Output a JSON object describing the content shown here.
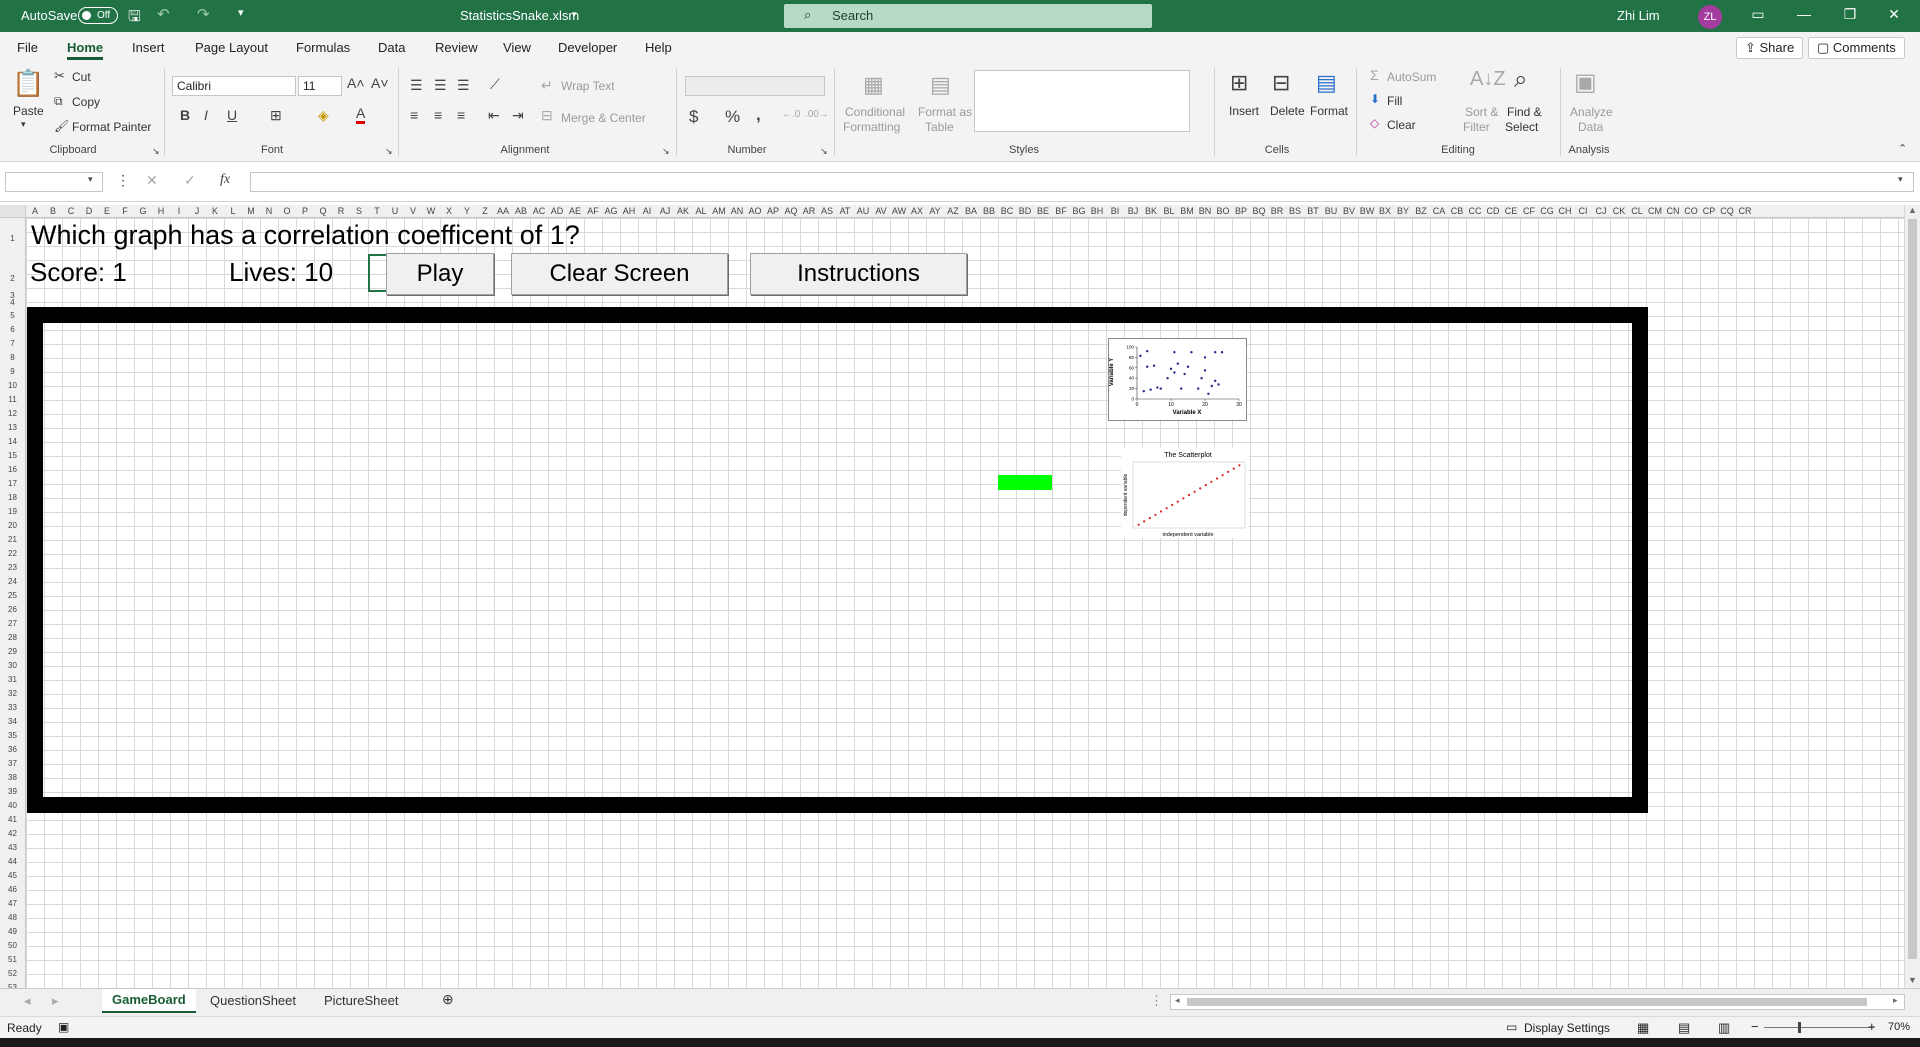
{
  "titlebar": {
    "autosave_label": "AutoSave",
    "autosave_state": "Off",
    "file_name": "StatisticsSnake.xlsm",
    "search_placeholder": "Search",
    "user_name": "Zhi Lim",
    "user_initials": "ZL",
    "brand_color": "#217346"
  },
  "menu": {
    "tabs": [
      "File",
      "Home",
      "Insert",
      "Page Layout",
      "Formulas",
      "Data",
      "Review",
      "View",
      "Developer",
      "Help"
    ],
    "active_tab": "Home",
    "share_label": "Share",
    "comments_label": "Comments"
  },
  "ribbon": {
    "clipboard": {
      "paste": "Paste",
      "cut": "Cut",
      "copy": "Copy",
      "format_painter": "Format Painter",
      "label": "Clipboard"
    },
    "font": {
      "name": "Calibri",
      "size": "11",
      "bold": "B",
      "italic": "I",
      "underline": "U",
      "label": "Font"
    },
    "alignment": {
      "wrap_text": "Wrap Text",
      "merge_center": "Merge & Center",
      "label": "Alignment"
    },
    "number": {
      "currency": "$",
      "percent": "%",
      "comma": ",",
      "label": "Number"
    },
    "styles": {
      "conditional_formatting": "Conditional",
      "conditional_formatting_2": "Formatting",
      "format_as_table": "Format as",
      "format_as_table_2": "Table",
      "label": "Styles"
    },
    "cells": {
      "insert": "Insert",
      "delete": "Delete",
      "format": "Format",
      "label": "Cells"
    },
    "editing": {
      "autosum": "AutoSum",
      "fill": "Fill",
      "clear": "Clear",
      "sort_filter": "Sort &",
      "sort_filter_2": "Filter",
      "find_select": "Find &",
      "find_select_2": "Select",
      "label": "Editing"
    },
    "analysis": {
      "analyze_data": "Analyze",
      "analyze_data_2": "Data",
      "label": "Analysis"
    }
  },
  "formula_bar": {
    "name_box": "",
    "fx": "fx",
    "content": ""
  },
  "sheet": {
    "columns": [
      "A",
      "B",
      "C",
      "D",
      "E",
      "F",
      "G",
      "H",
      "I",
      "J",
      "K",
      "L",
      "M",
      "N",
      "O",
      "P",
      "Q",
      "R",
      "S",
      "T",
      "U",
      "V",
      "W",
      "X",
      "Y",
      "Z",
      "AA",
      "AB",
      "AC",
      "AD",
      "AE",
      "AF",
      "AG",
      "AH",
      "AI",
      "AJ",
      "AK",
      "AL",
      "AM",
      "AN",
      "AO",
      "AP",
      "AQ",
      "AR",
      "AS",
      "AT",
      "AU",
      "AV",
      "AW",
      "AX",
      "AY",
      "AZ",
      "BA",
      "BB",
      "BC",
      "BD",
      "BE",
      "BF",
      "BG",
      "BH",
      "BI",
      "BJ",
      "BK",
      "BL",
      "BM",
      "BN",
      "BO",
      "BP",
      "BQ",
      "BR",
      "BS",
      "BT",
      "BU",
      "BV",
      "BW",
      "BX",
      "BY",
      "BZ",
      "CA",
      "CB",
      "CC",
      "CD",
      "CE",
      "CF",
      "CG",
      "CH",
      "CI",
      "CJ",
      "CK",
      "CL",
      "CM",
      "CN",
      "CO",
      "CP",
      "CQ",
      "CR"
    ],
    "question": "Which graph has a correlation coefficent of 1?",
    "score": "Score: 1",
    "lives": "Lives: 10",
    "buttons": {
      "play": "Play",
      "clear_screen": "Clear Screen",
      "instructions": "Instructions"
    },
    "snake_color": "#00ff00"
  },
  "chart_data": [
    {
      "type": "scatter",
      "title": "",
      "xlabel": "Variable X",
      "ylabel": "Variable Y",
      "xlim": [
        0,
        30
      ],
      "ylim": [
        0,
        100
      ],
      "xticks": [
        0,
        10,
        20,
        30
      ],
      "yticks": [
        0,
        20,
        40,
        60,
        80,
        100
      ],
      "points": [
        [
          1,
          83
        ],
        [
          2,
          15
        ],
        [
          3,
          92
        ],
        [
          3,
          62
        ],
        [
          4,
          18
        ],
        [
          5,
          64
        ],
        [
          6,
          22
        ],
        [
          7,
          20
        ],
        [
          9,
          40
        ],
        [
          10,
          58
        ],
        [
          11,
          90
        ],
        [
          11,
          51
        ],
        [
          12,
          68
        ],
        [
          13,
          20
        ],
        [
          14,
          48
        ],
        [
          15,
          62
        ],
        [
          16,
          90
        ],
        [
          18,
          20
        ],
        [
          19,
          40
        ],
        [
          20,
          80
        ],
        [
          20,
          55
        ],
        [
          21,
          10
        ],
        [
          22,
          25
        ],
        [
          23,
          35
        ],
        [
          23,
          90
        ],
        [
          24,
          28
        ],
        [
          25,
          90
        ]
      ],
      "color": "#1f2a8a"
    },
    {
      "type": "scatter",
      "title": "The Scatterplot",
      "xlabel": "independent variable",
      "ylabel": "dependent variable",
      "xlim": [
        0,
        20
      ],
      "ylim": [
        0,
        20
      ],
      "points": [
        [
          1,
          1
        ],
        [
          2,
          2
        ],
        [
          3,
          3
        ],
        [
          4,
          4
        ],
        [
          5,
          5
        ],
        [
          6,
          6
        ],
        [
          7,
          7
        ],
        [
          8,
          8
        ],
        [
          9,
          9
        ],
        [
          10,
          10
        ],
        [
          11,
          11
        ],
        [
          12,
          12
        ],
        [
          13,
          13
        ],
        [
          14,
          14
        ],
        [
          15,
          15
        ],
        [
          16,
          16
        ],
        [
          17,
          17
        ],
        [
          18,
          18
        ],
        [
          19,
          19
        ]
      ],
      "color": "#e02020"
    }
  ],
  "sheet_tabs": [
    "GameBoard",
    "QuestionSheet",
    "PictureSheet"
  ],
  "active_sheet": "GameBoard",
  "status": {
    "ready": "Ready",
    "display_settings": "Display Settings",
    "zoom": "70%"
  }
}
